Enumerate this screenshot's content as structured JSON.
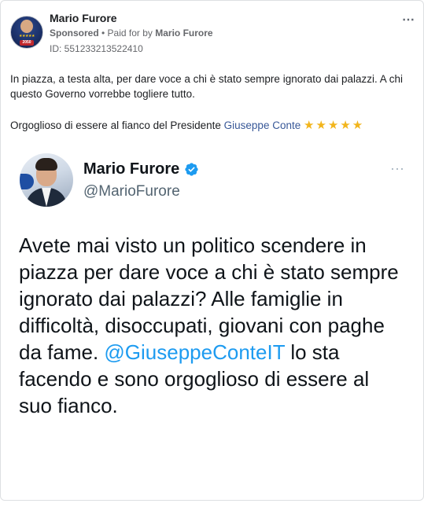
{
  "post": {
    "page_name": "Mario Furore",
    "sponsored_label": "Sponsored",
    "dot": " • ",
    "paid_for_prefix": "Paid for by ",
    "paid_for_name": "Mario Furore",
    "ad_id": "ID: 551233213522410",
    "more_icon": "⋯",
    "text_line1": "In piazza, a testa alta, per dare voce a chi è stato sempre ignorato dai palazzi. A chi questo Governo vorrebbe togliere tutto.",
    "text_line2_prefix": "Orgoglioso di essere al fianco del Presidente ",
    "text_line2_link": "Giuseppe Conte",
    "stars": "★★★★★",
    "avatar_year": "2050",
    "avatar_stars": "★★★★★"
  },
  "tweet": {
    "name": "Mario Furore",
    "handle": "@MarioFurore",
    "more_icon": "⋯",
    "text_before_mention": "Avete mai visto un politico scendere in piazza per dare voce a chi è stato sempre ignorato dai palazzi? Alle famiglie in difficoltà, disoccupati, giovani con paghe da fame. ",
    "mention": "@GiuseppeConteIT",
    "text_after_mention": " lo sta facendo e sono orgoglioso di essere al suo fianco."
  },
  "colors": {
    "link": "#385898",
    "mention": "#1d9bf0",
    "verified": "#1d9bf0",
    "stars": "#f2b51c"
  }
}
